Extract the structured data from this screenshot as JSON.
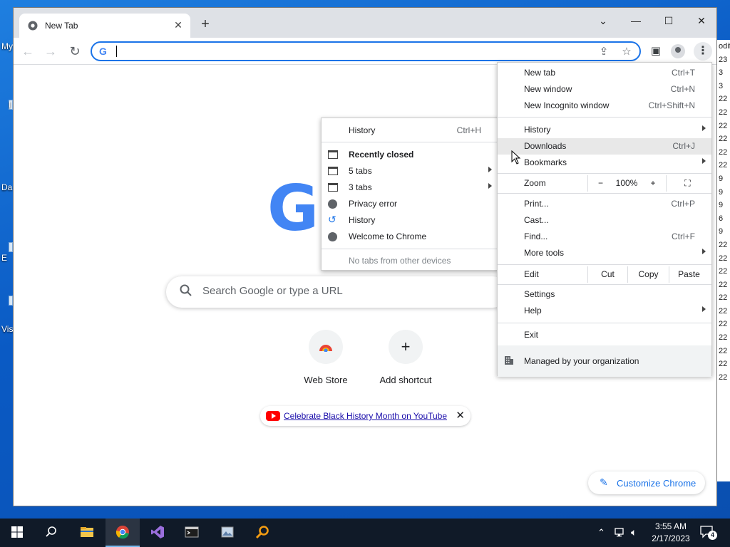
{
  "desktop": {
    "labels": [
      "My",
      "I",
      "Da",
      "E",
      "Vis"
    ]
  },
  "bg_window": {
    "rows": [
      "odifi",
      "23",
      "3",
      "3",
      "22",
      "22",
      "22",
      "22",
      "22",
      "22",
      "9",
      "9",
      "9",
      "6",
      "9",
      "22",
      "22",
      "22",
      "22",
      "22",
      "22",
      "22",
      "22",
      "22",
      "22",
      "22"
    ]
  },
  "tab": {
    "title": "New Tab",
    "close": "✕"
  },
  "window_controls": {
    "dropdown": "⌄",
    "minimize": "—",
    "maximize": "☐",
    "close": "✕"
  },
  "page": {
    "logo_text": "G",
    "search_placeholder": "Search Google or type a URL",
    "shortcuts": [
      {
        "label": "Web Store",
        "icon": "webstore-icon"
      },
      {
        "label": "Add shortcut",
        "icon": "plus-icon",
        "glyph": "+"
      }
    ],
    "promo_text": "Celebrate Black History Month on YouTube",
    "customize_label": "Customize Chrome"
  },
  "main_menu": {
    "items": [
      {
        "label": "New tab",
        "accel": "Ctrl+T"
      },
      {
        "label": "New window",
        "accel": "Ctrl+N"
      },
      {
        "label": "New Incognito window",
        "accel": "Ctrl+Shift+N"
      },
      {
        "label": "History",
        "accel": ""
      },
      {
        "label": "Downloads",
        "accel": "Ctrl+J"
      },
      {
        "label": "Bookmarks",
        "accel": ""
      },
      {
        "label": "Zoom",
        "accel": ""
      },
      {
        "label": "Print...",
        "accel": "Ctrl+P"
      },
      {
        "label": "Cast...",
        "accel": ""
      },
      {
        "label": "Find...",
        "accel": "Ctrl+F"
      },
      {
        "label": "More tools",
        "accel": ""
      },
      {
        "label": "Edit",
        "accel": ""
      },
      {
        "label": "Settings",
        "accel": ""
      },
      {
        "label": "Help",
        "accel": ""
      },
      {
        "label": "Exit",
        "accel": ""
      }
    ],
    "zoom": {
      "minus": "−",
      "value": "100%",
      "plus": "+"
    },
    "edit": {
      "cut": "Cut",
      "copy": "Copy",
      "paste": "Paste"
    },
    "managed": "Managed by your organization"
  },
  "history_menu": {
    "header": {
      "label": "History",
      "accel": "Ctrl+H"
    },
    "recently_closed": "Recently closed",
    "items": [
      "5 tabs",
      "3 tabs",
      "Privacy error",
      "History",
      "Welcome to Chrome"
    ],
    "other_devices": "No tabs from other devices"
  },
  "tray": {
    "time": "3:55 AM",
    "date": "2/17/2023",
    "notifications": "4"
  }
}
